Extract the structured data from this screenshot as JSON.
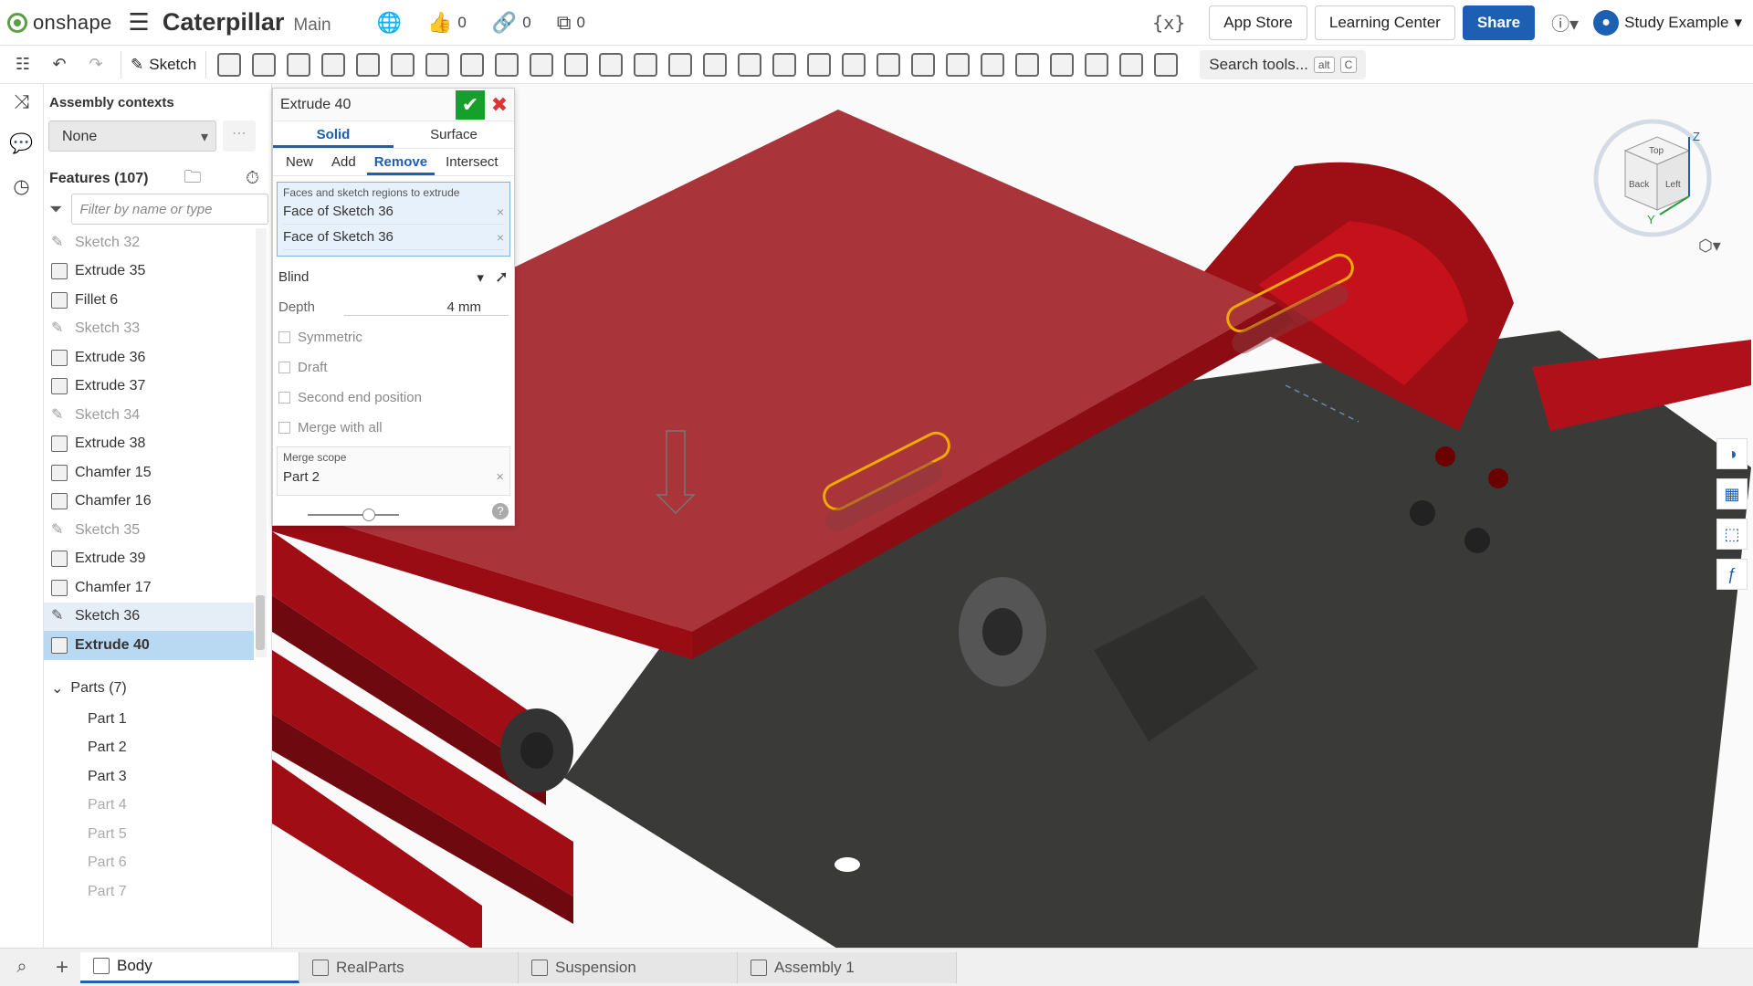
{
  "header": {
    "logo_text": "onshape",
    "doc_title": "Caterpillar",
    "branch": "Main",
    "likes": "0",
    "links": "0",
    "copies": "0",
    "var_icon": "{x}",
    "app_store": "App Store",
    "learning_center": "Learning Center",
    "share": "Share",
    "user_name": "Study Example"
  },
  "toolbar": {
    "sketch_label": "Sketch",
    "search_tools": "Search tools...",
    "search_kbd_1": "alt",
    "search_kbd_2": "C"
  },
  "panel": {
    "contexts_title": "Assembly contexts",
    "context_value": "None",
    "features_title": "Features (107)",
    "filter_placeholder": "Filter by name or type",
    "features": [
      {
        "label": "Sketch 32",
        "kind": "sketch"
      },
      {
        "label": "Extrude 35",
        "kind": "extrude"
      },
      {
        "label": "Fillet 6",
        "kind": "fillet"
      },
      {
        "label": "Sketch 33",
        "kind": "sketch"
      },
      {
        "label": "Extrude 36",
        "kind": "extrude"
      },
      {
        "label": "Extrude 37",
        "kind": "extrude"
      },
      {
        "label": "Sketch 34",
        "kind": "sketch"
      },
      {
        "label": "Extrude 38",
        "kind": "extrude"
      },
      {
        "label": "Chamfer 15",
        "kind": "chamfer"
      },
      {
        "label": "Chamfer 16",
        "kind": "chamfer"
      },
      {
        "label": "Sketch 35",
        "kind": "sketch"
      },
      {
        "label": "Extrude 39",
        "kind": "extrude"
      },
      {
        "label": "Chamfer 17",
        "kind": "chamfer"
      },
      {
        "label": "Sketch 36",
        "kind": "sketch-active"
      },
      {
        "label": "Extrude 40",
        "kind": "selected"
      }
    ],
    "parts_title": "Parts (7)",
    "parts": [
      "Part 1",
      "Part 2",
      "Part 3",
      "Part 4",
      "Part 5",
      "Part 6",
      "Part 7"
    ]
  },
  "extrude": {
    "title": "Extrude 40",
    "tab_solid": "Solid",
    "tab_surface": "Surface",
    "op_new": "New",
    "op_add": "Add",
    "op_remove": "Remove",
    "op_intersect": "Intersect",
    "faces_label": "Faces and sketch regions to extrude",
    "face_1": "Face of Sketch 36",
    "face_2": "Face of Sketch 36",
    "end_type": "Blind",
    "depth_label": "Depth",
    "depth_value": "4 mm",
    "symmetric": "Symmetric",
    "draft": "Draft",
    "second_end": "Second end position",
    "merge_all": "Merge with all",
    "merge_scope_label": "Merge scope",
    "merge_scope_value": "Part 2",
    "help": "?"
  },
  "viewcube": {
    "top": "Top",
    "back": "Back",
    "left": "Left",
    "z": "Z",
    "y": "Y"
  },
  "tabs": {
    "body": "Body",
    "realparts": "RealParts",
    "suspension": "Suspension",
    "assembly": "Assembly 1"
  },
  "colors": {
    "accent": "#1d5fb2",
    "model_red": "#c4111b",
    "model_dark": "#3a3a38",
    "sketch_yellow": "#f1a800",
    "ok_green": "#16a02b"
  }
}
